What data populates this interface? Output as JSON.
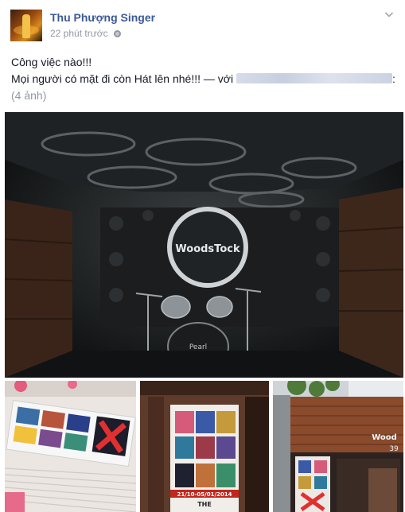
{
  "author": {
    "name": "Thu Phượng Singer",
    "timestamp": "22 phút trước",
    "privacy_icon": "globe-icon",
    "avatar_icon": "avatar-photo"
  },
  "menu_icon": "chevron-down-icon",
  "post": {
    "line1": "Công việc nào!!!",
    "line2": "Mọi người có mặt đi còn Hát lên nhé!!! — với",
    "line2_end": ":",
    "photo_count": "(4 ảnh)"
  },
  "photos": {
    "main": {
      "sign_text": "WoodsTock",
      "drum_brand": "Pearl"
    },
    "photo3": {
      "poster_banner": "21/10-05/01/2014",
      "poster_the": "THE"
    },
    "photo4": {
      "storefront_sign": "Wood",
      "storefront_number": "39"
    }
  },
  "colors": {
    "link": "#3b5998",
    "text": "#141823",
    "meta": "#9197a3"
  }
}
